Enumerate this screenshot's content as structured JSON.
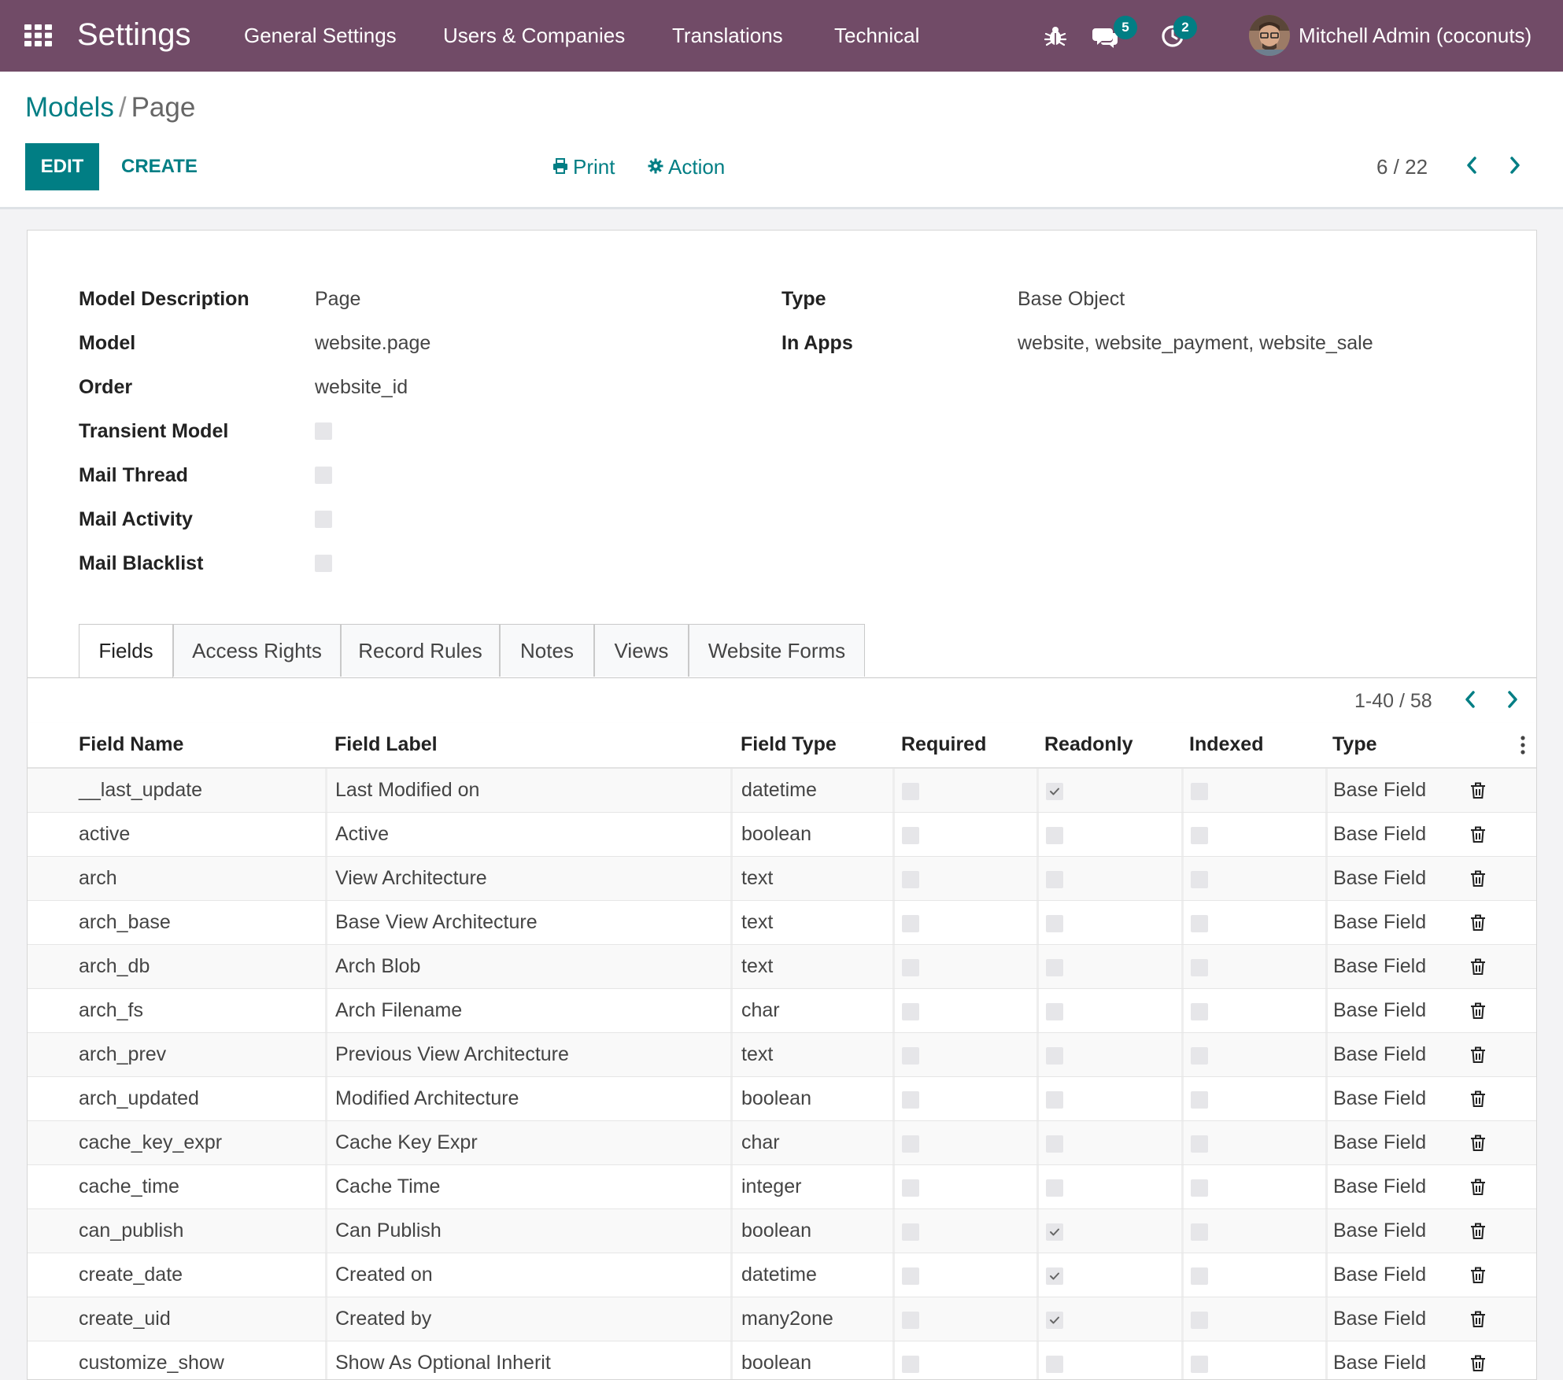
{
  "navbar": {
    "app_title": "Settings",
    "menus": [
      "General Settings",
      "Users & Companies",
      "Translations",
      "Technical"
    ],
    "messages_badge": "5",
    "activities_badge": "2",
    "user_name": "Mitchell Admin (coconuts)",
    "icons": [
      "apps-grid-icon",
      "bug-icon",
      "chat-icon",
      "clock-icon"
    ]
  },
  "control_panel": {
    "breadcrumb_parent": "Models",
    "breadcrumb_separator": "/",
    "breadcrumb_current": "Page",
    "edit_label": "EDIT",
    "create_label": "CREATE",
    "print_label": "Print",
    "action_label": "Action",
    "pager": "6 / 22"
  },
  "form": {
    "left": [
      {
        "label": "Model Description",
        "value": "Page"
      },
      {
        "label": "Model",
        "value": "website.page"
      },
      {
        "label": "Order",
        "value": "website_id"
      },
      {
        "label": "Transient Model",
        "checked": false
      },
      {
        "label": "Mail Thread",
        "checked": false
      },
      {
        "label": "Mail Activity",
        "checked": false
      },
      {
        "label": "Mail Blacklist",
        "checked": false
      }
    ],
    "right": [
      {
        "label": "Type",
        "value": "Base Object"
      },
      {
        "label": "In Apps",
        "value": "website, website_payment, website_sale"
      }
    ]
  },
  "tabs": [
    "Fields",
    "Access Rights",
    "Record Rules",
    "Notes",
    "Views",
    "Website Forms"
  ],
  "active_tab": "Fields",
  "fields_list": {
    "pager": "1-40 / 58",
    "columns": [
      "Field Name",
      "Field Label",
      "Field Type",
      "Required",
      "Readonly",
      "Indexed",
      "Type"
    ],
    "rows": [
      {
        "name": "__last_update",
        "label": "Last Modified on",
        "ftype": "datetime",
        "required": false,
        "readonly": true,
        "indexed": false,
        "type": "Base Field"
      },
      {
        "name": "active",
        "label": "Active",
        "ftype": "boolean",
        "required": false,
        "readonly": false,
        "indexed": false,
        "type": "Base Field"
      },
      {
        "name": "arch",
        "label": "View Architecture",
        "ftype": "text",
        "required": false,
        "readonly": false,
        "indexed": false,
        "type": "Base Field"
      },
      {
        "name": "arch_base",
        "label": "Base View Architecture",
        "ftype": "text",
        "required": false,
        "readonly": false,
        "indexed": false,
        "type": "Base Field"
      },
      {
        "name": "arch_db",
        "label": "Arch Blob",
        "ftype": "text",
        "required": false,
        "readonly": false,
        "indexed": false,
        "type": "Base Field"
      },
      {
        "name": "arch_fs",
        "label": "Arch Filename",
        "ftype": "char",
        "required": false,
        "readonly": false,
        "indexed": false,
        "type": "Base Field"
      },
      {
        "name": "arch_prev",
        "label": "Previous View Architecture",
        "ftype": "text",
        "required": false,
        "readonly": false,
        "indexed": false,
        "type": "Base Field"
      },
      {
        "name": "arch_updated",
        "label": "Modified Architecture",
        "ftype": "boolean",
        "required": false,
        "readonly": false,
        "indexed": false,
        "type": "Base Field"
      },
      {
        "name": "cache_key_expr",
        "label": "Cache Key Expr",
        "ftype": "char",
        "required": false,
        "readonly": false,
        "indexed": false,
        "type": "Base Field"
      },
      {
        "name": "cache_time",
        "label": "Cache Time",
        "ftype": "integer",
        "required": false,
        "readonly": false,
        "indexed": false,
        "type": "Base Field"
      },
      {
        "name": "can_publish",
        "label": "Can Publish",
        "ftype": "boolean",
        "required": false,
        "readonly": true,
        "indexed": false,
        "type": "Base Field"
      },
      {
        "name": "create_date",
        "label": "Created on",
        "ftype": "datetime",
        "required": false,
        "readonly": true,
        "indexed": false,
        "type": "Base Field"
      },
      {
        "name": "create_uid",
        "label": "Created by",
        "ftype": "many2one",
        "required": false,
        "readonly": true,
        "indexed": false,
        "type": "Base Field"
      },
      {
        "name": "customize_show",
        "label": "Show As Optional Inherit",
        "ftype": "boolean",
        "required": false,
        "readonly": false,
        "indexed": false,
        "type": "Base Field"
      }
    ]
  },
  "colors": {
    "navbar": "#714b67",
    "accent": "#017e84",
    "badge": "#017e84"
  }
}
